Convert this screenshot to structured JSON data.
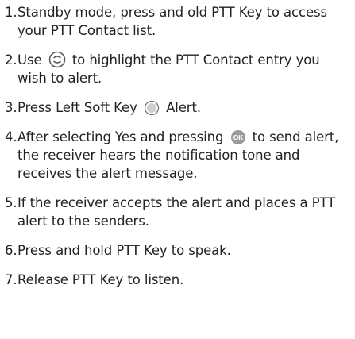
{
  "steps": [
    {
      "number": "1.",
      "text": "Standby mode, press and old PTT Key to access your PTT Contact list."
    },
    {
      "number": "2.",
      "text_before": "Use",
      "icon": "navigation-key-icon",
      "text_after": "to highlight the PTT Contact entry you wish to alert."
    },
    {
      "number": "3.",
      "text_before": "Press Left Soft Key",
      "icon": "left-soft-key-icon",
      "text_after": "Alert."
    },
    {
      "number": "4.",
      "text_before": "After selecting Yes and pressing",
      "icon": "ok-key-icon",
      "icon_label": "OK",
      "text_after": "to send alert, the receiver hears the notification tone and receives the alert message."
    },
    {
      "number": "5.",
      "text": "If the receiver accepts the alert and places a PTT alert to the senders."
    },
    {
      "number": "6.",
      "text": "Press and hold PTT Key to speak."
    },
    {
      "number": "7.",
      "text": "Release PTT Key to listen."
    }
  ],
  "colors": {
    "text": "#222222",
    "icon_fill": "#cfcfcf",
    "icon_stroke": "#555555"
  }
}
